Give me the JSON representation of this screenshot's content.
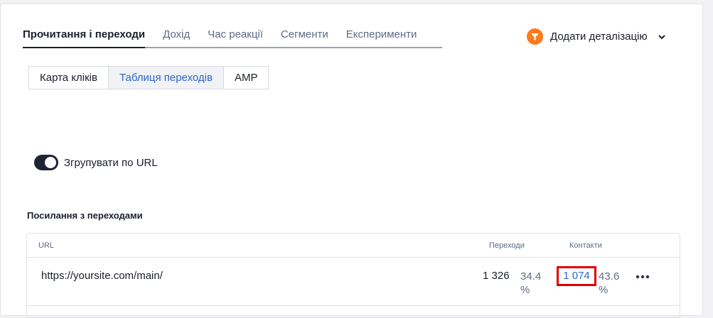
{
  "tabs": [
    {
      "label": "Прочитання і переходи",
      "active": true
    },
    {
      "label": "Дохід",
      "active": false
    },
    {
      "label": "Час реакції",
      "active": false
    },
    {
      "label": "Сегменти",
      "active": false
    },
    {
      "label": "Експерименти",
      "active": false
    }
  ],
  "add_detail": {
    "label": "Додати деталізацію",
    "icon": "funnel-icon",
    "accent": "#ff7a1a"
  },
  "view_switch": [
    {
      "label": "Карта кліків",
      "active": false
    },
    {
      "label": "Таблиця переходів",
      "active": true
    },
    {
      "label": "AMP",
      "active": false
    }
  ],
  "group_toggle": {
    "label": "Згрупувати по URL",
    "on": true
  },
  "section_title": "Посилання з переходами",
  "table": {
    "headers": {
      "url": "URL",
      "transitions": "Переходи",
      "contacts": "Контакти"
    },
    "rows": [
      {
        "url": "https://yoursite.com/main/",
        "transitions": "1 326",
        "transitions_pct": "34.4 %",
        "contacts": "1 074",
        "contacts_pct": "43.6 %"
      }
    ]
  },
  "colors": {
    "link": "#2f66c7",
    "highlight": "#e00000",
    "toggle": "#1f2434"
  }
}
